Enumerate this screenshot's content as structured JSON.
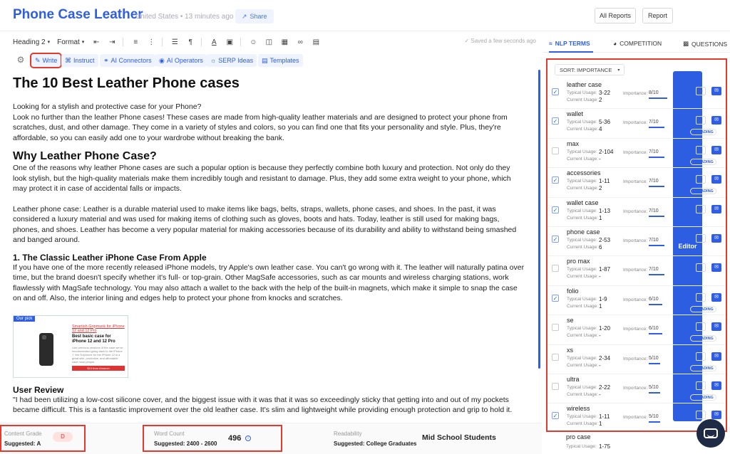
{
  "header": {
    "title": "Phone Case Leather",
    "meta": "United States • 13 minutes ago",
    "share": "Share",
    "all_reports": "All Reports",
    "report": "Report",
    "editor": "Editor"
  },
  "toolbar": {
    "heading": "Heading 2",
    "format": "Format",
    "saved": "Saved a few seconds ago"
  },
  "actions": {
    "write": "Write",
    "instruct": "Instruct",
    "connectors": "AI Connectors",
    "operators": "AI Operators",
    "serp": "SERP Ideas",
    "templates": "Templates"
  },
  "content": {
    "h1": "The 10 Best Leather Phone cases",
    "intro_q": "Looking for a stylish and protective case for your Phone?",
    "intro": "Look no further than the leather Phone cases! These cases are made from high-quality leather materials and are designed to protect your phone from scratches, dust, and other damage. They come in a variety of styles and colors, so you can find one that fits your personality and style. Plus, they're affordable, so you can easily add one to your wardrobe without breaking the bank.",
    "h2": "Why Leather Phone Case?",
    "why": "One of the reasons why leather Phone cases are such a popular option is because they perfectly combine both luxury and protection. Not only do they look stylish, but the high-quality materials make them incredibly tough and resistant to damage. Plus, they add some extra weight to your phone, which may protect it in case of accidental falls or impacts.",
    "leather": "Leather phone case: Leather is a durable material used to make items like bags, belts, straps, wallets, phone cases, and shoes. In the past, it was considered a luxury material and was used for making items of clothing such as gloves, boots and hats. Today, leather is still used for making bags, phones, and shoes. Leather has become a very popular material for making accessories because of its durability and ability to withstand being smashed and banged around.",
    "h3": "1. The Classic Leather iPhone Case From Apple",
    "apple": "If you have one of the more recently released iPhone models, try Apple's own leather case. You can't go wrong with it. The leather will naturally patina over time, but the brand doesn't specify whether it's full- or top-grain. Other MagSafe accessories, such as car mounts and wireless charging stations, work flawlessly with MagSafe technology. You may also attach a wallet to the back with the help of the built-in magnets, which make it simple to snap the case on and off. Also, the interior lining and edges help to protect your phone from knocks and scratches.",
    "card_tag": "Our pick",
    "card_link": "Smartish Gripmunk for iPhone 12 and 12 Pro",
    "card_head": "Best basic case for iPhone 12 and 12 Pro",
    "card_text": "Like previous versions of the case we've recommended going back to the iPhone 7, the Gripmunk for the iPhone 12 is a great slim, protective, and affordable case most people.",
    "card_btn": "$10 from Amazon",
    "review_h": "User Review",
    "review": "\"I had been utilizing a low-cost silicone cover, and the biggest issue with it was that it was so exceedingly sticky that getting into and out of my pockets became difficult. This is a fantastic improvement over the old leather case. It's slim and lightweight while providing enough protection and grip to hold it."
  },
  "panel": {
    "tabs": [
      "NLP TERMS",
      "COMPETITION",
      "QUESTIONS"
    ],
    "sort": "SORT: IMPORTANCE",
    "labels": {
      "typical": "Typical Usage:",
      "current": "Current Usage:",
      "importance": "Importance:",
      "heading": "HEADING"
    },
    "terms": [
      {
        "name": "leather case",
        "typical": "3-22",
        "current": "2",
        "importance": "8/10",
        "checked": true,
        "heading": false
      },
      {
        "name": "wallet",
        "typical": "5-36",
        "current": "4",
        "importance": "7/10",
        "checked": true,
        "heading": true
      },
      {
        "name": "max",
        "typical": "2-104",
        "current": "-",
        "importance": "7/10",
        "checked": false,
        "heading": true
      },
      {
        "name": "accessories",
        "typical": "1-11",
        "current": "2",
        "importance": "7/10",
        "checked": true,
        "heading": true
      },
      {
        "name": "wallet case",
        "typical": "1-13",
        "current": "1",
        "importance": "7/10",
        "checked": true,
        "heading": false
      },
      {
        "name": "phone case",
        "typical": "2-53",
        "current": "6",
        "importance": "7/10",
        "checked": true,
        "heading": false
      },
      {
        "name": "pro max",
        "typical": "1-87",
        "current": "-",
        "importance": "7/10",
        "checked": false,
        "heading": false
      },
      {
        "name": "folio",
        "typical": "1-9",
        "current": "1",
        "importance": "6/10",
        "checked": true,
        "heading": true
      },
      {
        "name": "se",
        "typical": "1-20",
        "current": "-",
        "importance": "6/10",
        "checked": false,
        "heading": true
      },
      {
        "name": "xs",
        "typical": "2-34",
        "current": "-",
        "importance": "5/10",
        "checked": false,
        "heading": true
      },
      {
        "name": "ultra",
        "typical": "2-22",
        "current": "-",
        "importance": "5/10",
        "checked": false,
        "heading": true
      },
      {
        "name": "wireless",
        "typical": "1-11",
        "current": "1",
        "importance": "5/10",
        "checked": true,
        "heading": false
      }
    ],
    "extra": {
      "name": "pro case",
      "typical": "1-75"
    }
  },
  "footer": {
    "grade_label": "Content Grade",
    "grade_suggested": "Suggested: A",
    "grade_value": "D",
    "wc_label": "Word Count",
    "wc_suggested": "Suggested: 2400 - 2600",
    "wc_value": "496",
    "read_label": "Readability",
    "read_suggested": "Suggested: College Graduates",
    "read_value": "Mid School Students"
  },
  "colors": {
    "accent": "#2f5ee3",
    "highlight": "#e23b2e"
  }
}
